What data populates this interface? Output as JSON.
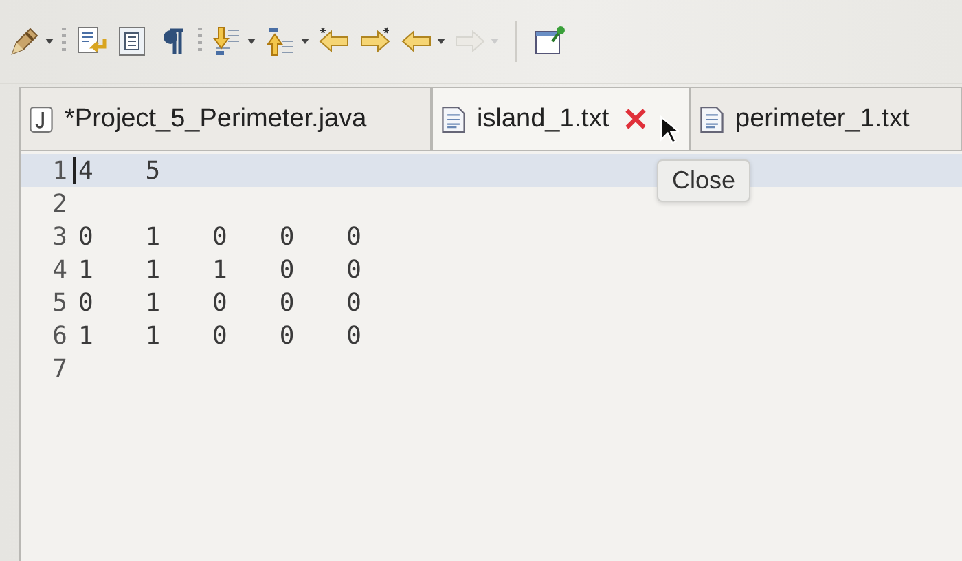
{
  "toolbar": {
    "tools": [
      {
        "kind": "pen",
        "dropdown": true,
        "disabled": false
      },
      {
        "kind": "separator"
      },
      {
        "kind": "doc-arrow",
        "dropdown": false,
        "disabled": false
      },
      {
        "kind": "list",
        "dropdown": false,
        "disabled": false
      },
      {
        "kind": "pilcrow",
        "dropdown": false,
        "disabled": false
      },
      {
        "kind": "separator"
      },
      {
        "kind": "down-list",
        "dropdown": true,
        "disabled": false
      },
      {
        "kind": "up-list",
        "dropdown": true,
        "disabled": false
      },
      {
        "kind": "back-star",
        "dropdown": false,
        "disabled": false
      },
      {
        "kind": "forward-star",
        "dropdown": false,
        "disabled": false
      },
      {
        "kind": "back",
        "dropdown": true,
        "disabled": false
      },
      {
        "kind": "forward",
        "dropdown": true,
        "disabled": true
      },
      {
        "kind": "divider"
      },
      {
        "kind": "pin-window",
        "dropdown": false,
        "disabled": false
      }
    ]
  },
  "tabs": [
    {
      "label": "*Project_5_Perimeter.java",
      "kind": "java",
      "selected": false
    },
    {
      "label": "island_1.txt",
      "kind": "text",
      "selected": true
    },
    {
      "label": "perimeter_1.txt",
      "kind": "text",
      "selected": false
    }
  ],
  "tooltip": "Close",
  "editor": {
    "lines": [
      {
        "number": "1",
        "text": "4\t5",
        "current": true
      },
      {
        "number": "2",
        "current": false
      },
      {
        "number": "3",
        "text": "0\t1\t0\t0\t0",
        "current": false
      },
      {
        "number": "4",
        "text": "1\t1\t1\t0\t0",
        "current": false
      },
      {
        "number": "5",
        "text": "0\t1\t0\t0\t0",
        "current": false
      },
      {
        "number": "6",
        "text": "1\t1\t0\t0\t0",
        "current": false
      },
      {
        "number": "7",
        "current": false
      }
    ]
  }
}
